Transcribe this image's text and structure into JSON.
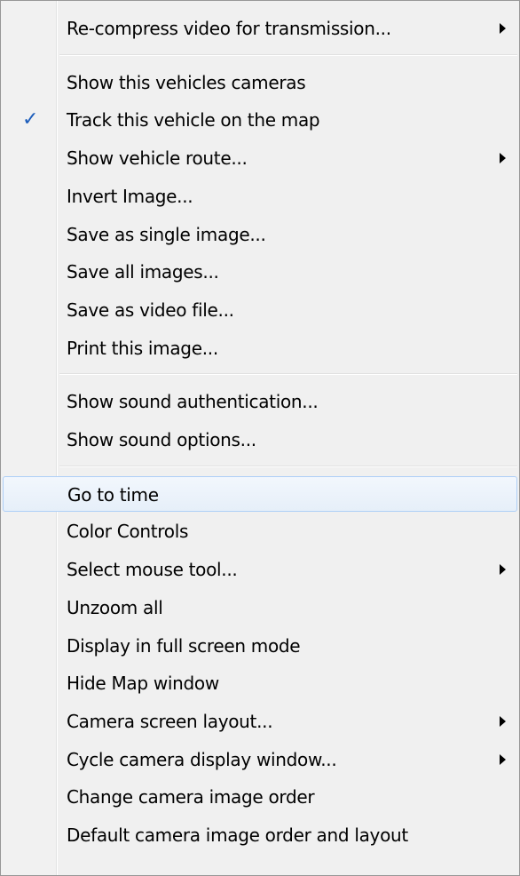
{
  "menu": {
    "sections": [
      {
        "items": [
          {
            "label": "Re-compress video for transmission...",
            "submenu": true
          }
        ]
      },
      {
        "items": [
          {
            "label": "Show this vehicles cameras"
          },
          {
            "label": "Track this vehicle on the map",
            "checked": true
          },
          {
            "label": "Show vehicle route...",
            "submenu": true
          },
          {
            "label": "Invert Image..."
          },
          {
            "label": "Save as single image..."
          },
          {
            "label": "Save all images..."
          },
          {
            "label": "Save as video file..."
          },
          {
            "label": "Print this image..."
          }
        ]
      },
      {
        "items": [
          {
            "label": "Show sound authentication..."
          },
          {
            "label": "Show sound options..."
          }
        ]
      },
      {
        "items": [
          {
            "label": "Go to time",
            "highlighted": true
          },
          {
            "label": "Color Controls"
          },
          {
            "label": "Select mouse tool...",
            "submenu": true
          },
          {
            "label": "Unzoom all"
          },
          {
            "label": "Display in full screen mode"
          },
          {
            "label": "Hide Map window"
          },
          {
            "label": "Camera screen layout...",
            "submenu": true
          },
          {
            "label": "Cycle camera display window...",
            "submenu": true
          },
          {
            "label": "Change camera image order"
          },
          {
            "label": "Default camera image order and layout"
          }
        ]
      }
    ],
    "check_glyph": "✓",
    "colors": {
      "check": "#1c5dbb",
      "highlight_border": "#aecff7",
      "highlight_fill": "#e6eff9"
    }
  }
}
